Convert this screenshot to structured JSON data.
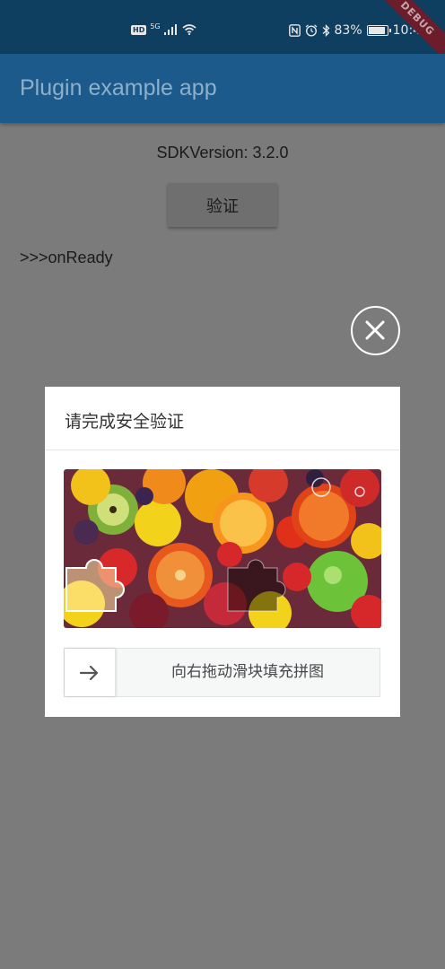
{
  "status_bar": {
    "hd_badge": "HD",
    "network": "5G",
    "battery": "83%",
    "battery_level": 0.83,
    "time": "10:43",
    "debug_banner": "DEBUG",
    "icons": [
      "signal-icon",
      "wifi-icon",
      "nfc-icon",
      "alarm-icon",
      "bluetooth-icon",
      "battery-icon"
    ]
  },
  "app_bar": {
    "title": "Plugin example app"
  },
  "main": {
    "sdk_version": "SDKVersion: 3.2.0",
    "verify_button": "验证",
    "log": ">>>onReady"
  },
  "captcha": {
    "close_icon": "close-icon",
    "title": "请完成安全验证",
    "slider_hint": "向右拖动滑块填充拼图",
    "slider_icon": "arrow-right-icon"
  },
  "colors": {
    "status_bar": "#0e3e60",
    "app_bar": "#1b5a8a",
    "overlay_background": "#7b7b7b",
    "dialog": "#ffffff"
  }
}
